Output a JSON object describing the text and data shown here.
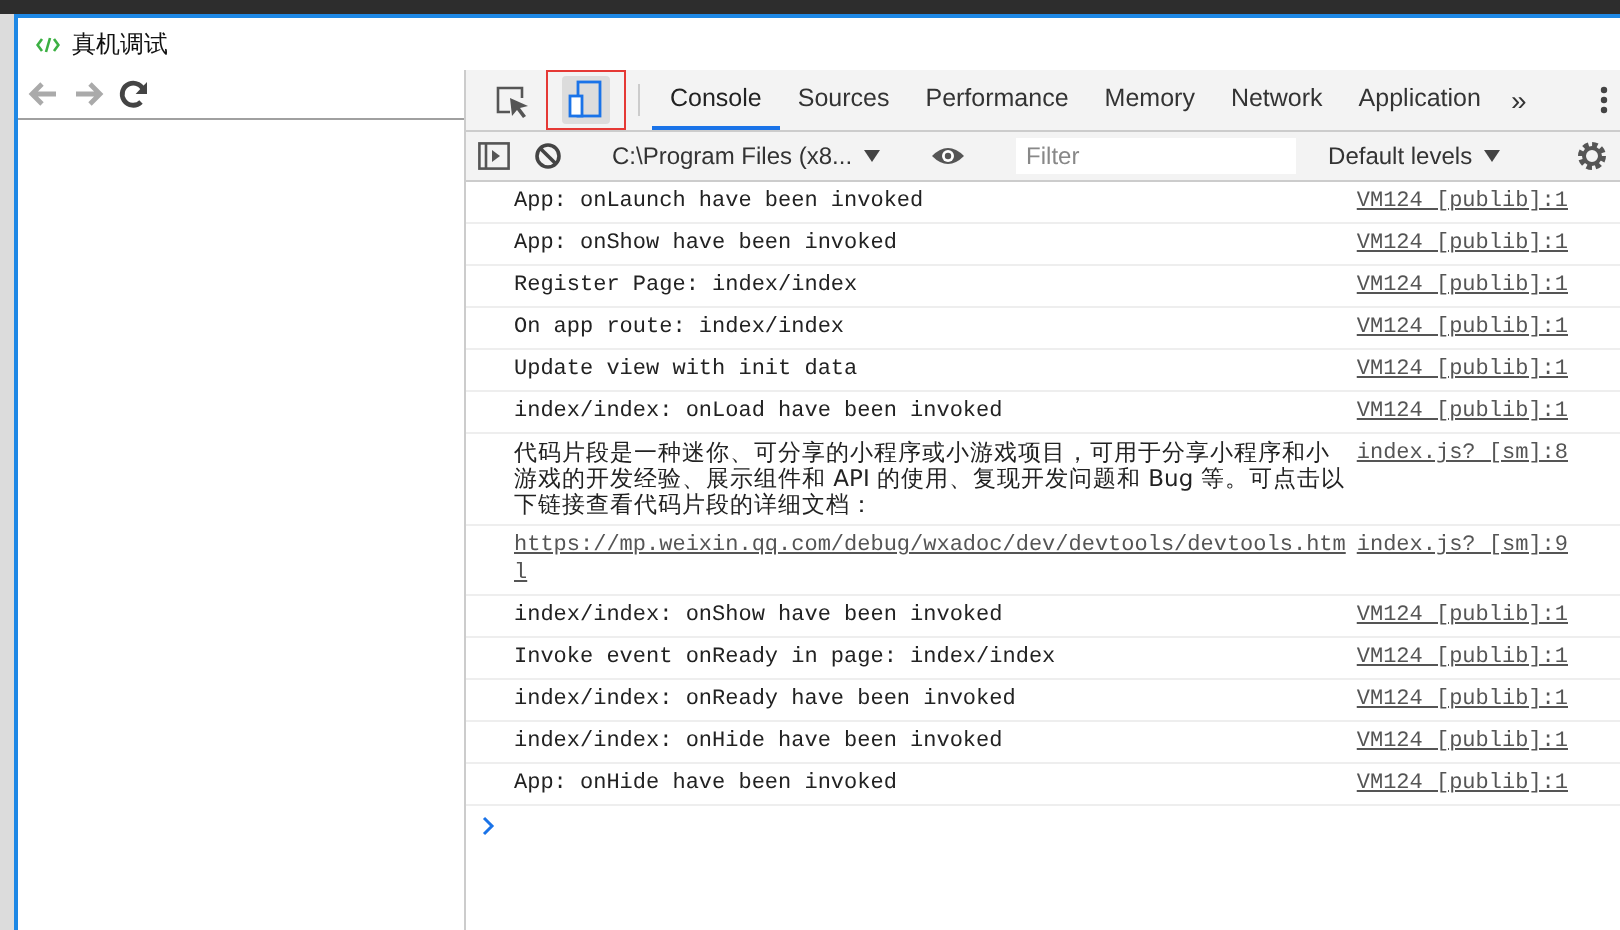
{
  "window": {
    "title": "真机调试"
  },
  "nav": [
    {
      "kind": "back",
      "disabled": true
    },
    {
      "kind": "forward",
      "disabled": true
    },
    {
      "kind": "reload",
      "disabled": false
    }
  ],
  "devtools": {
    "tools": [
      {
        "kind": "inspect",
        "selected": false,
        "highlighted": false
      },
      {
        "kind": "device",
        "selected": true,
        "highlighted": true
      }
    ],
    "tabs": [
      {
        "label": "Console",
        "selected": true
      },
      {
        "label": "Sources",
        "selected": false
      },
      {
        "label": "Performance",
        "selected": false
      },
      {
        "label": "Memory",
        "selected": false
      },
      {
        "label": "Network",
        "selected": false
      },
      {
        "label": "Application",
        "selected": false
      }
    ],
    "more_tabs": "»",
    "console_toolbar": {
      "context": "C:\\Program Files (x8...",
      "filter": {
        "placeholder": "Filter"
      },
      "levels": "Default levels"
    },
    "logs": [
      {
        "kind": "text",
        "message": "App: onLaunch have been invoked",
        "source": "VM124 [publib]:1"
      },
      {
        "kind": "text",
        "message": "App: onShow have been invoked",
        "source": "VM124 [publib]:1"
      },
      {
        "kind": "text",
        "message": "Register Page: index/index",
        "source": "VM124 [publib]:1"
      },
      {
        "kind": "text",
        "message": "On app route: index/index",
        "source": "VM124 [publib]:1"
      },
      {
        "kind": "text",
        "message": "Update view with init data",
        "source": "VM124 [publib]:1"
      },
      {
        "kind": "text",
        "message": "index/index: onLoad have been invoked",
        "source": "VM124 [publib]:1"
      },
      {
        "kind": "text",
        "message": "代码片段是一种迷你、可分享的小程序或小游戏项目，可用于分享小程序和小游戏的开发经验、展示组件和 API 的使用、复现开发问题和 Bug 等。可点击以下链接查看代码片段的详细文档：",
        "source": "index.js? [sm]:8"
      },
      {
        "kind": "link",
        "message": "https://mp.weixin.qq.com/debug/wxadoc/dev/devtools/devtools.html",
        "source": "index.js? [sm]:9"
      },
      {
        "kind": "text",
        "message": "index/index: onShow have been invoked",
        "source": "VM124 [publib]:1"
      },
      {
        "kind": "text",
        "message": "Invoke event onReady in page: index/index",
        "source": "VM124 [publib]:1"
      },
      {
        "kind": "text",
        "message": "index/index: onReady have been invoked",
        "source": "VM124 [publib]:1"
      },
      {
        "kind": "text",
        "message": "index/index: onHide have been invoked",
        "source": "VM124 [publib]:1"
      },
      {
        "kind": "text",
        "message": "App: onHide have been invoked",
        "source": "VM124 [publib]:1"
      }
    ]
  }
}
